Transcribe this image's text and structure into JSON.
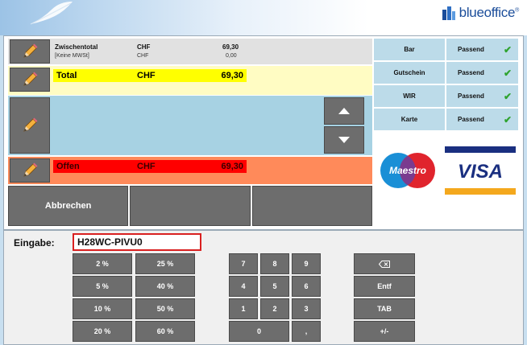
{
  "header": {
    "brand": "blueoffice",
    "brand_mark": "®",
    "brand_color": "#1b4d9a"
  },
  "summary": {
    "zwischentotal_label": "Zwischentotal",
    "zwischentotal_currency": "CHF",
    "zwischentotal_value": "69,30",
    "mwst_label": "[Keine MWSt]",
    "mwst_currency": "CHF",
    "mwst_value": "0,00"
  },
  "total": {
    "label": "Total",
    "currency": "CHF",
    "value": "69,30"
  },
  "offen": {
    "label": "Offen",
    "currency": "CHF",
    "value": "69,30"
  },
  "actions": {
    "cancel_label": "Abbrechen"
  },
  "payments": [
    {
      "name": "Bar",
      "status": "Passend"
    },
    {
      "name": "Gutschein",
      "status": "Passend"
    },
    {
      "name": "WIR",
      "status": "Passend"
    },
    {
      "name": "Karte",
      "status": "Passend"
    }
  ],
  "cards": {
    "maestro": "Maestro",
    "visa": "VISA"
  },
  "input": {
    "label": "Eingabe:",
    "value": "H28WC-PIVU0"
  },
  "keypad": {
    "percent": [
      "2 %",
      "25 %",
      "5 %",
      "40 %",
      "10 %",
      "50 %",
      "20 %",
      "60 %"
    ],
    "digits": [
      "7",
      "8",
      "9",
      "4",
      "5",
      "6",
      "1",
      "2",
      "3",
      "0",
      ","
    ],
    "functions": [
      "⌫",
      "Entf",
      "TAB",
      "+/-"
    ]
  },
  "colors": {
    "total_highlight": "#ffff00",
    "offen_highlight": "#ff0000",
    "button_gray": "#6d6d6d",
    "check_green": "#2fa32f"
  }
}
